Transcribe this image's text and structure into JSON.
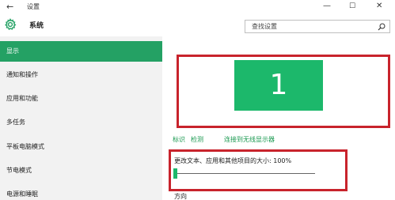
{
  "titlebar": {
    "back_icon": "back-arrow-icon",
    "back_glyph": "←",
    "title": "设置",
    "minimize_glyph": "—",
    "maximize_glyph": "☐",
    "close_glyph": "✕"
  },
  "header": {
    "section_icon": "gear-icon",
    "section_title": "系统",
    "search_placeholder": "查找设置",
    "search_icon": "search-icon"
  },
  "sidebar": {
    "items": [
      {
        "label": "显示",
        "active": true
      },
      {
        "label": "通知和操作",
        "active": false
      },
      {
        "label": "应用和功能",
        "active": false
      },
      {
        "label": "多任务",
        "active": false
      },
      {
        "label": "平板电脑模式",
        "active": false
      },
      {
        "label": "节电模式",
        "active": false
      },
      {
        "label": "电源和睡眠",
        "active": false
      }
    ]
  },
  "main": {
    "monitor_number": "1",
    "links": {
      "identify": "标识",
      "detect": "检测",
      "wireless": "连接到无线显示器"
    },
    "scale_label": "更改文本、应用和其他项目的大小: 100%",
    "scale_slider_position": 0,
    "orientation_label": "方向"
  },
  "colors": {
    "accent": "#1cb86b",
    "sidebar_active": "#24a164",
    "highlight_box": "#c8232c",
    "sidebar_bg": "#f2f2f2"
  }
}
